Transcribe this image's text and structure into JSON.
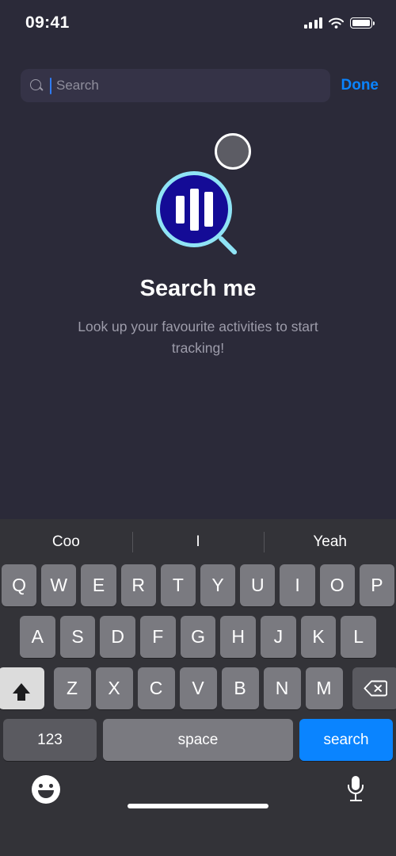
{
  "status_bar": {
    "time": "09:41",
    "signal_icon": "cellular-signal-icon",
    "wifi_icon": "wifi-icon",
    "battery_icon": "battery-full-icon"
  },
  "search_header": {
    "search_icon": "search-icon",
    "placeholder": "Search",
    "value": "",
    "done_label": "Done"
  },
  "empty_state": {
    "bubble_icon": "circle-bubble-icon",
    "illustration_icon": "magnifier-bar-chart-icon",
    "title": "Search me",
    "subtitle": "Look up your favourite activities to start tracking!",
    "chart_bars": [
      35,
      53,
      44
    ]
  },
  "keyboard": {
    "suggestions": [
      "Coo",
      "I",
      "Yeah"
    ],
    "row1": [
      "Q",
      "W",
      "E",
      "R",
      "T",
      "Y",
      "U",
      "I",
      "O",
      "P"
    ],
    "row2": [
      "A",
      "S",
      "D",
      "F",
      "G",
      "H",
      "J",
      "K",
      "L"
    ],
    "row3": [
      "Z",
      "X",
      "C",
      "V",
      "B",
      "N",
      "M"
    ],
    "shift_icon": "shift-key-icon",
    "backspace_icon": "backspace-key-icon",
    "numbers_label": "123",
    "space_label": "space",
    "return_label": "search",
    "emoji_icon": "emoji-smiley-icon",
    "dictation_icon": "microphone-icon"
  },
  "colors": {
    "background": "#2b2a39",
    "search_field": "#353347",
    "accent_blue": "#0a84ff",
    "keyboard_bg": "#333338",
    "key_bg": "#7a7a80",
    "special_key_bg": "#5a5a60",
    "magnifier_fill": "#140b96",
    "magnifier_rim": "#8fe3f5"
  }
}
